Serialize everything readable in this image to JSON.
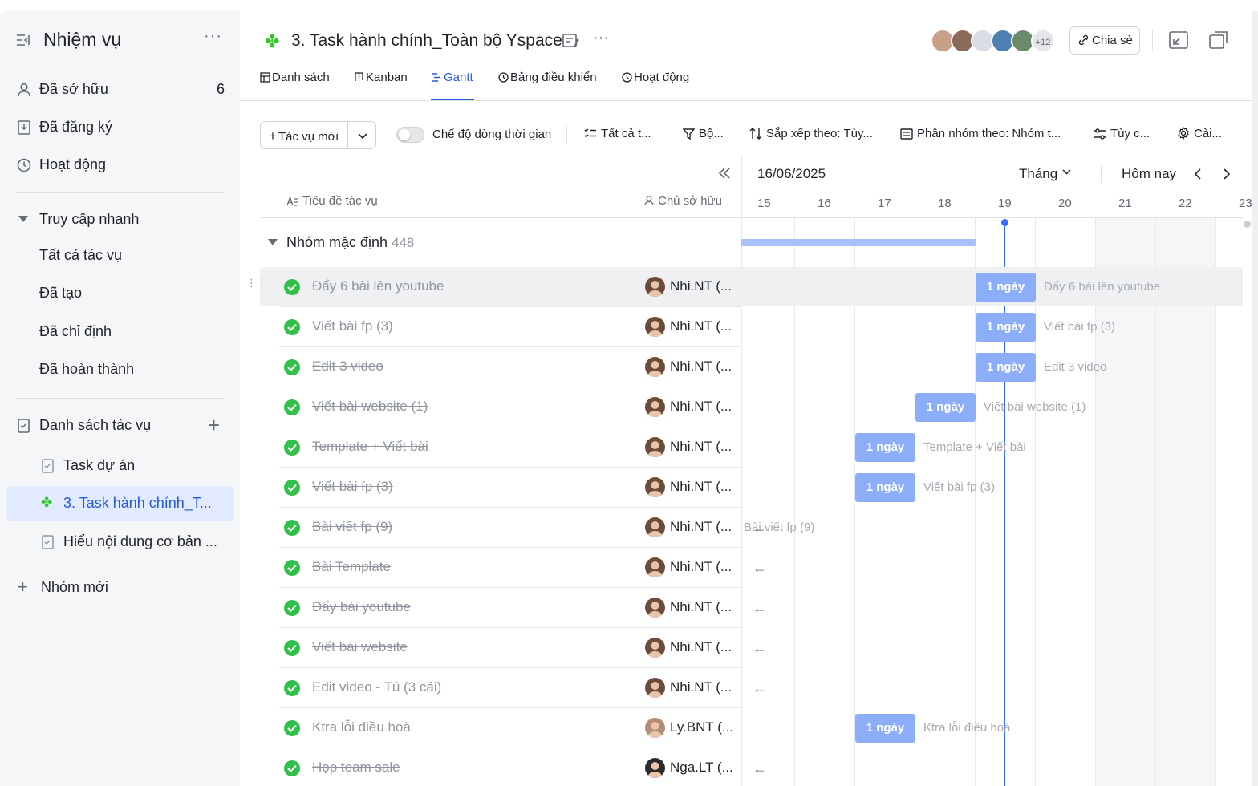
{
  "sidebar": {
    "title": "Nhiệm vụ",
    "items": [
      {
        "label": "Đã sở hữu",
        "count": "6",
        "icon": "person-icon"
      },
      {
        "label": "Đã đăng ký",
        "icon": "bookmark-icon"
      },
      {
        "label": "Hoạt động",
        "icon": "history-icon"
      }
    ],
    "quick_access": {
      "label": "Truy cập nhanh",
      "items": [
        "Tất cả tác vụ",
        "Đã tạo",
        "Đã chỉ định",
        "Đã hoàn thành"
      ]
    },
    "task_lists": {
      "label": "Danh sách tác vụ",
      "items": [
        {
          "label": "Task dự án",
          "icon": "tasklist-icon"
        },
        {
          "label": "3. Task hành chính_T...",
          "icon": "clover-icon",
          "active": true
        },
        {
          "label": "Hiểu nội dung cơ bản ...",
          "icon": "tasklist-icon"
        }
      ]
    },
    "new_group": "Nhóm mới"
  },
  "header": {
    "title": "3. Task hành chính_Toàn bộ Yspace",
    "avatar_more": "+12",
    "share_label": "Chia sẻ"
  },
  "tabs": [
    {
      "label": "Danh sách",
      "icon": "table-icon"
    },
    {
      "label": "Kanban",
      "icon": "kanban-icon"
    },
    {
      "label": "Gantt",
      "icon": "gantt-icon",
      "active": true
    },
    {
      "label": "Bảng điều khiển",
      "icon": "dashboard-icon"
    },
    {
      "label": "Hoạt động",
      "icon": "history-icon"
    }
  ],
  "toolbar": {
    "new_task": "Tác vụ mới",
    "timeline_mode": "Chế độ dòng thời gian",
    "all_tasks": "Tất cả t...",
    "filter": "Bộ...",
    "sort": "Sắp xếp theo: Tùy...",
    "group_by": "Phân nhóm theo: Nhóm t...",
    "customize": "Tùy c...",
    "settings": "Cài..."
  },
  "table": {
    "col_title": "Tiêu đề tác vụ",
    "col_owner": "Chủ sở hữu",
    "group": {
      "label": "Nhóm mặc định",
      "count": "448"
    },
    "rows": [
      {
        "name": "Đẩy 6 bài lên youtube",
        "owner": "Nhi.NT (...",
        "bar": "1 ngày",
        "bar_label": "Đẩy 6 bài lên youtube",
        "day": 18,
        "arrow": ""
      },
      {
        "name": "Viết bài fp (3)",
        "owner": "Nhi.NT (...",
        "bar": "1 ngày",
        "bar_label": "Viết bài fp (3)",
        "day": 18,
        "arrow": ""
      },
      {
        "name": "Edit 3 video",
        "owner": "Nhi.NT (...",
        "bar": "1 ngày",
        "bar_label": "Edit 3 video",
        "day": 18,
        "arrow": ""
      },
      {
        "name": "Viết bài website (1)",
        "owner": "Nhi.NT (...",
        "bar": "1 ngày",
        "bar_label": "Viết bài website (1)",
        "day": 17,
        "arrow": ""
      },
      {
        "name": "Template + Viết bài",
        "owner": "Nhi.NT (...",
        "bar": "1 ngày",
        "bar_label": "Template + Viết bài",
        "day": 16,
        "arrow": ""
      },
      {
        "name": "Viết bài fp (3)",
        "owner": "Nhi.NT (...",
        "bar": "1 ngày",
        "bar_label": "Viết bài fp (3)",
        "day": 16,
        "arrow": ""
      },
      {
        "name": "Bài viết fp (9)",
        "owner": "Nhi.NT (...",
        "bar": "",
        "bar_label": "Bài viết fp (9)",
        "day": 0,
        "arrow": "←"
      },
      {
        "name": "Bài Template",
        "owner": "Nhi.NT (...",
        "bar": "",
        "bar_label": "",
        "day": 0,
        "arrow": "←"
      },
      {
        "name": "Đẩy bài youtube",
        "owner": "Nhi.NT (...",
        "bar": "",
        "bar_label": "",
        "day": 0,
        "arrow": "←"
      },
      {
        "name": "Viết bài website",
        "owner": "Nhi.NT (...",
        "bar": "",
        "bar_label": "",
        "day": 0,
        "arrow": "←"
      },
      {
        "name": "Edit video - Tú (3 cái)",
        "owner": "Nhi.NT (...",
        "bar": "",
        "bar_label": "",
        "day": 0,
        "arrow": "←"
      },
      {
        "name": "Ktra lỗi điều hoà",
        "owner": "Ly.BNT (...",
        "bar": "1 ngày",
        "bar_label": "Ktra lỗi điều hoà",
        "day": 16,
        "arrow": ""
      },
      {
        "name": "Họp team sale",
        "owner": "Nga.LT (...",
        "bar": "",
        "bar_label": "",
        "day": 0,
        "arrow": "←"
      }
    ]
  },
  "gantt": {
    "date": "16/06/2025",
    "mode": "Tháng",
    "today": "Hôm nay",
    "days": [
      "15",
      "16",
      "17",
      "18",
      "19",
      "20",
      "21",
      "22",
      "23"
    ],
    "today_day": 19
  },
  "colors": {
    "accent": "#245bdb",
    "bar": "#8cadf8",
    "done": "#32c04b"
  }
}
